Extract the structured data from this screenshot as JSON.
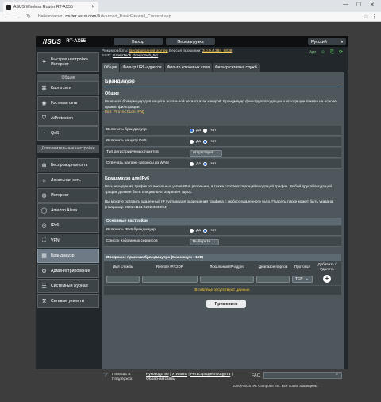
{
  "browser": {
    "tab_title": "ASUS Wireless Router RT-AX55",
    "address_warning": "Небезопасно",
    "url_host": "router.asus.com",
    "url_path": "/Advanced_BasicFirewall_Content.asp"
  },
  "header": {
    "logo": "/ISUS",
    "model": "RT-AX55",
    "logout": "Выход",
    "reboot": "Перезагрузка",
    "language": "Русский"
  },
  "status": {
    "mode_label": "Режим работы:",
    "mode_value": "Беспроводной роутер",
    "fw_label": "Версия прошивки:",
    "fw_value": "3.0.0.4.384_9839",
    "ssid_label": "SSID:",
    "ssid1": "GreenTech",
    "ssid2": "GreenTech_5G",
    "app_label": "App"
  },
  "sidebar": {
    "quick": "Быстрая настройка Интернет",
    "general_header": "Общие",
    "general": [
      "Карта сети",
      "Гостевая сеть",
      "AiProtection",
      "QoS"
    ],
    "advanced_header": "Дополнительные настройки",
    "advanced": [
      "Беспроводная сеть",
      "Локальная сеть",
      "Интернет",
      "Amazon Alexa",
      "IPv6",
      "VPN",
      "Брандмауэр",
      "Администрирование",
      "Системный журнал",
      "Сетевые утилиты"
    ]
  },
  "tabs": [
    "Общие",
    "Фильтр URL-адресов",
    "Фильтр ключевых слов",
    "Фильтр сетевых служб"
  ],
  "main": {
    "title": "Брандмауэр",
    "general_title": "Общие",
    "general_desc": "Включите брандмауэр для защиты локальной сети от атак хакеров. Брандмауэр фильтрует входящие и исходящие пакеты на основе правил фильтрации.",
    "dos_faq": "DoS Protection FAQ",
    "rows": [
      {
        "label": "Включить брандмауэр",
        "type": "radio",
        "on": "Да"
      },
      {
        "label": "Включить защиту DoS",
        "type": "radio",
        "on": "Нет"
      },
      {
        "label": "Тип регистрируемых пакетов",
        "type": "select",
        "value": "отсутствует"
      },
      {
        "label": "Отвечать на пинг-запросы из WAN",
        "type": "radio",
        "on": "Нет"
      }
    ],
    "yes": "Да",
    "no": "Нет",
    "ipv6_title": "Брандмауэр для IPv6",
    "ipv6_desc1": "Весь исходящий трафик от локальных узлов IPv6 разрешен, а также соответствующий входящий трафик. Любой другой входящий трафик должен быть специально разрешен здесь.",
    "ipv6_desc2": "Вы можете оставить удаленный IP пустым для разрешения трафика с любого удаленного узла. Подсеть также может быть указана. (Например 2001::1111:2222:3333/64)",
    "basic_header": "Основные настройки",
    "ipv6_row": {
      "label": "Включить IPv6 брандмауэр",
      "on": "Нет"
    },
    "fav_row": {
      "label": "Список избранных сервисов",
      "value": "Выберите"
    },
    "rules_header": "Входящие правила брандмауэра (Максимум : 128)",
    "cols": [
      "Имя службы",
      "Remote IP/CIDR",
      "Локальный IP-адрес",
      "Диапазон портов",
      "Протокол",
      "Добавить / Удалить"
    ],
    "protocol": "TCP",
    "no_data": "В таблице отсутствуют данные.",
    "apply": "Применить"
  },
  "footer": {
    "help_label": "Помощь & Поддержка",
    "links": [
      "Руководство",
      "Утилиты",
      "Регистрация продукта",
      "Обратная связь"
    ],
    "faq": "FAQ",
    "copyright": "2020 ASUSTeK Computer Inc. Все права защищены."
  }
}
